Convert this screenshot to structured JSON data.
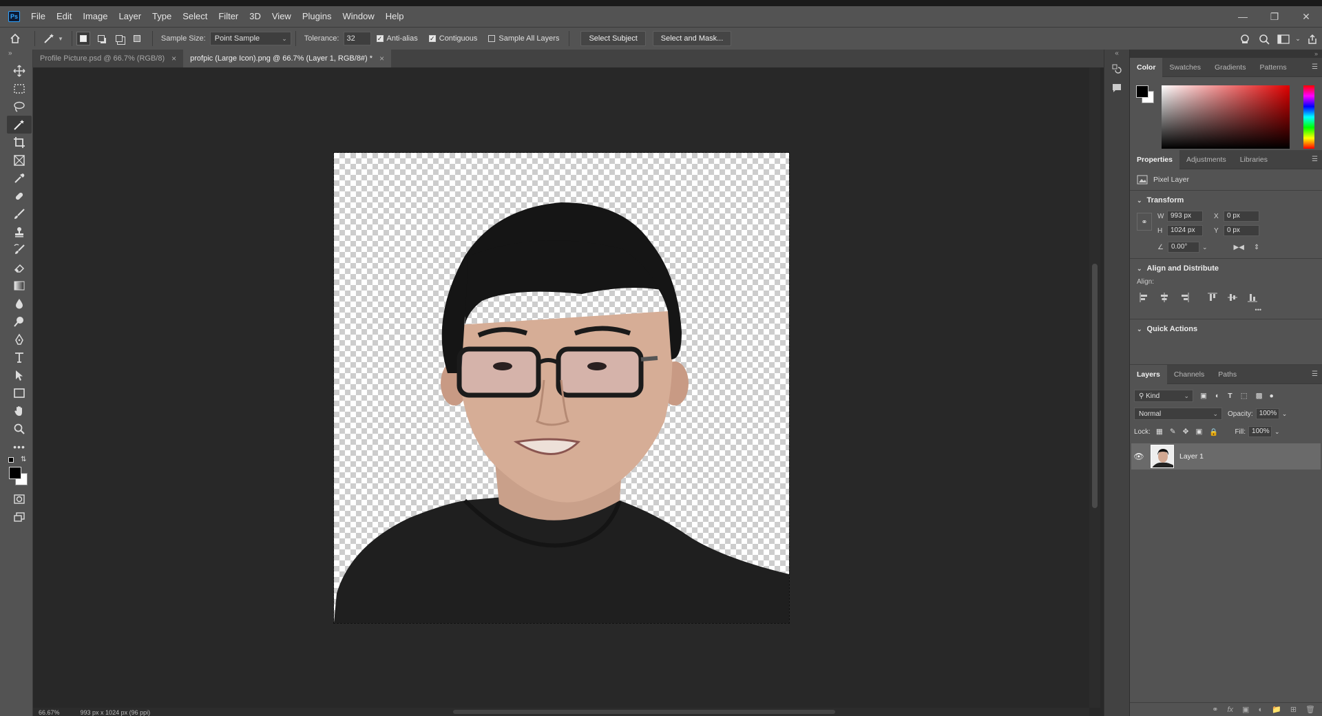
{
  "app": {
    "logo": "Ps"
  },
  "menu": [
    "File",
    "Edit",
    "Image",
    "Layer",
    "Type",
    "Select",
    "Filter",
    "3D",
    "View",
    "Plugins",
    "Window",
    "Help"
  ],
  "options": {
    "sample_size_label": "Sample Size:",
    "sample_size_value": "Point Sample",
    "tolerance_label": "Tolerance:",
    "tolerance_value": "32",
    "anti_alias": "Anti-alias",
    "contiguous": "Contiguous",
    "sample_all_layers": "Sample All Layers",
    "select_subject": "Select Subject",
    "select_and_mask": "Select and Mask..."
  },
  "tabs": [
    {
      "label": "Profile Picture.psd @ 66.7% (RGB/8)"
    },
    {
      "label": "profpic (Large Icon).png @ 66.7% (Layer 1, RGB/8#) *"
    }
  ],
  "status": {
    "zoom": "66.67%",
    "doc_info": "993 px x 1024 px (96 ppi)"
  },
  "color_panel": {
    "tabs": [
      "Color",
      "Swatches",
      "Gradients",
      "Patterns"
    ],
    "foreground": "#000000",
    "background": "#ffffff"
  },
  "properties": {
    "tabs": [
      "Properties",
      "Adjustments",
      "Libraries"
    ],
    "kind": "Pixel Layer",
    "transform_title": "Transform",
    "w_label": "W",
    "w_value": "993 px",
    "h_label": "H",
    "h_value": "1024 px",
    "x_label": "X",
    "x_value": "0 px",
    "y_label": "Y",
    "y_value": "0 px",
    "angle_value": "0.00°",
    "align_title": "Align and Distribute",
    "align_label": "Align:",
    "more": "•••",
    "quick_actions": "Quick Actions"
  },
  "layers": {
    "tabs": [
      "Layers",
      "Channels",
      "Paths"
    ],
    "filter_kind": "Kind",
    "blend_mode": "Normal",
    "opacity_label": "Opacity:",
    "opacity_value": "100%",
    "lock_label": "Lock:",
    "fill_label": "Fill:",
    "fill_value": "100%",
    "items": [
      {
        "name": "Layer 1"
      }
    ]
  }
}
